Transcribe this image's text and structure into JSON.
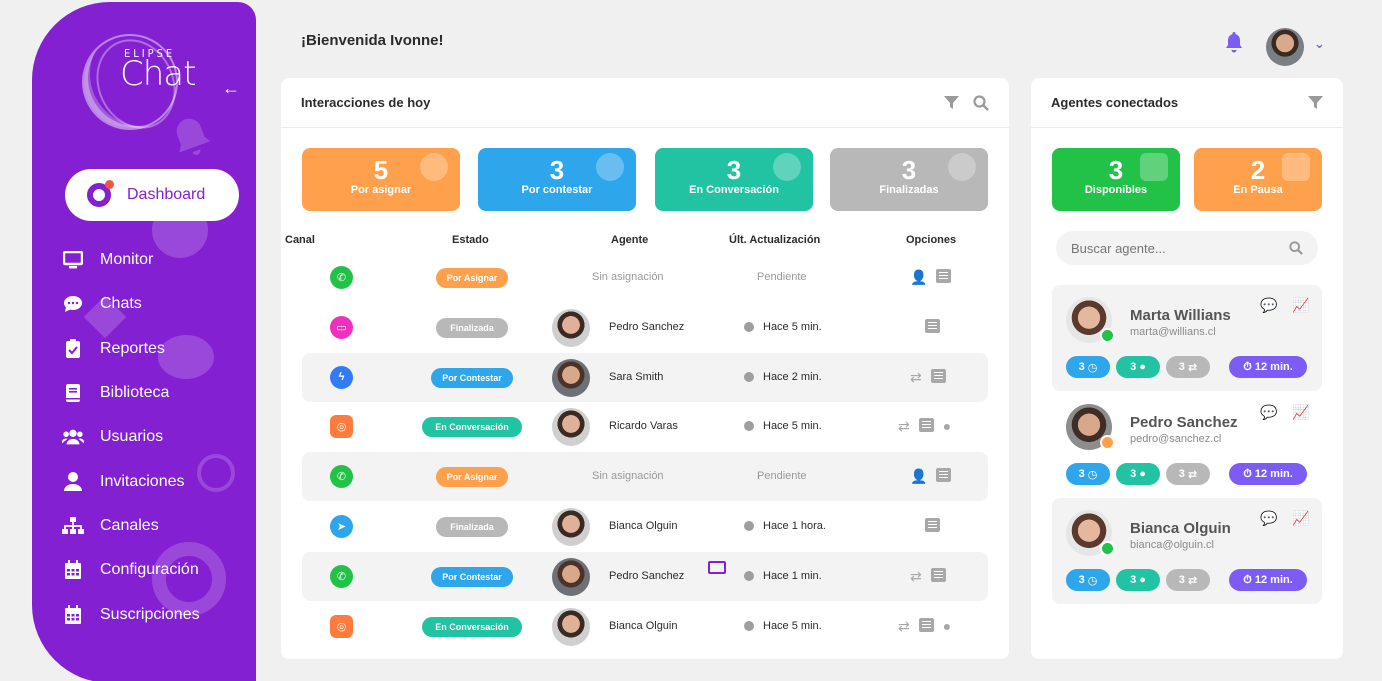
{
  "app": {
    "brand_top": "ELIPSE",
    "brand_main": "Chat"
  },
  "colors": {
    "primary": "#8320d2",
    "orange": "#ffa04d",
    "blue": "#2ea6ec",
    "teal": "#22c3a2",
    "gray": "#b8b8b8",
    "green": "#22c148",
    "violet": "#7c5cf5",
    "pink": "#ef2fbd"
  },
  "sidebar": {
    "collapse_icon": "arrow-left-icon",
    "active": {
      "label": "Dashboard",
      "icon": "dashboard-icon"
    },
    "items": [
      {
        "label": "Monitor",
        "icon": "monitor-icon"
      },
      {
        "label": "Chats",
        "icon": "chat-bubble-icon"
      },
      {
        "label": "Reportes",
        "icon": "clipboard-check-icon"
      },
      {
        "label": "Biblioteca",
        "icon": "book-icon"
      },
      {
        "label": "Usuarios",
        "icon": "users-icon"
      },
      {
        "label": "Invitaciones",
        "icon": "user-icon"
      },
      {
        "label": "Canales",
        "icon": "sitemap-icon"
      },
      {
        "label": "Configuración",
        "icon": "calendar-icon"
      },
      {
        "label": "Suscripciones",
        "icon": "calendar-icon"
      }
    ]
  },
  "header": {
    "welcome": "¡Bienvenida Ivonne!",
    "bell_icon": "bell-icon",
    "user_menu_icon": "chevron-down-icon"
  },
  "interactions": {
    "title": "Interacciones de hoy",
    "stats": [
      {
        "value": "5",
        "label": "Por asignar",
        "icon": "clock-icon"
      },
      {
        "value": "3",
        "label": "Por contestar",
        "icon": "chat-clock-icon"
      },
      {
        "value": "3",
        "label": "En Conversación",
        "icon": "chat-dots-icon"
      },
      {
        "value": "3",
        "label": "Finalizadas",
        "icon": "check-circle-icon"
      }
    ],
    "columns": [
      "Canal",
      "Estado",
      "Agente",
      "Últ. Actualización",
      "Opciones"
    ],
    "rows": [
      {
        "channel": "whatsapp",
        "status": "Por Asignar",
        "agent": "Sin asignación",
        "updated": "Pendiente",
        "options": [
          "assign-user",
          "details"
        ]
      },
      {
        "channel": "web",
        "status": "Finalizada",
        "agent": "Pedro Sanchez",
        "updated": "Hace 5 min.",
        "options": [
          "details"
        ]
      },
      {
        "channel": "messenger",
        "status": "Por Contestar",
        "agent": "Sara Smith",
        "updated": "Hace 2 min.",
        "options": [
          "transfer",
          "details"
        ]
      },
      {
        "channel": "instagram",
        "status": "En Conversación",
        "agent": "Ricardo Varas",
        "updated": "Hace 5 min.",
        "options": [
          "transfer",
          "details",
          "chat"
        ]
      },
      {
        "channel": "whatsapp",
        "status": "Por Asignar",
        "agent": "Sin asignación",
        "updated": "Pendiente",
        "options": [
          "assign-user",
          "details"
        ]
      },
      {
        "channel": "telegram",
        "status": "Finalizada",
        "agent": "Bianca Olguin",
        "updated": "Hace 1 hora.",
        "options": [
          "details"
        ]
      },
      {
        "channel": "whatsapp",
        "status": "Por Contestar",
        "agent": "Pedro Sanchez",
        "updated": "Hace 1 min.",
        "options": [
          "transfer",
          "details"
        ],
        "unread_mail": true
      },
      {
        "channel": "instagram",
        "status": "En Conversación",
        "agent": "Bianca Olguin",
        "updated": "Hace 5 min.",
        "options": [
          "transfer",
          "details",
          "chat"
        ]
      }
    ]
  },
  "agents": {
    "title": "Agentes conectados",
    "stats": [
      {
        "value": "3",
        "label": "Disponibles",
        "icon": "user-check-icon"
      },
      {
        "value": "2",
        "label": "En Pausa",
        "icon": "user-clock-icon"
      }
    ],
    "search_placeholder": "Buscar agente...",
    "list": [
      {
        "name": "Marta Willians",
        "email": "marta@willians.cl",
        "status": "available",
        "pending": "3",
        "chats": "3",
        "transfers": "3",
        "time": "12 min."
      },
      {
        "name": "Pedro Sanchez",
        "email": "pedro@sanchez.cl",
        "status": "lunch",
        "pending": "3",
        "chats": "3",
        "transfers": "3",
        "time": "12 min."
      },
      {
        "name": "Bianca Olguin",
        "email": "bianca@olguin.cl",
        "status": "available",
        "pending": "3",
        "chats": "3",
        "transfers": "3",
        "time": "12 min."
      }
    ]
  }
}
